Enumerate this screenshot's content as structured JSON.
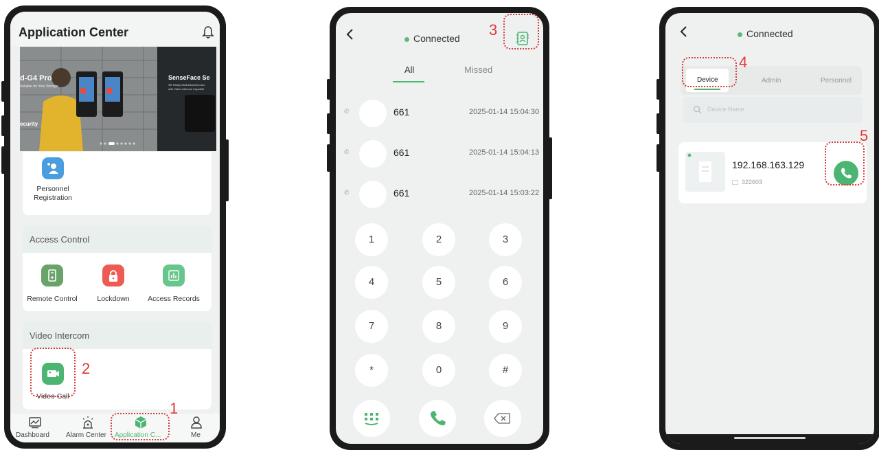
{
  "phone1": {
    "title": "Application Center",
    "banner": {
      "left_text": "d-G4 Pro",
      "left_sub": "Solution for Your Storage",
      "left_bottom": "ecurity",
      "right_text": "SenseFace Se",
      "right_sub": "SR Ready Multi-Biometric Acc",
      "right_sub2": "with Video Intercom Capabilit"
    },
    "personnel_registration": [
      "Personnel",
      "Registration"
    ],
    "access_control": {
      "title": "Access Control",
      "items": [
        "Remote Control",
        "Lockdown",
        "Access Records"
      ]
    },
    "video_intercom": {
      "title": "Video Intercom",
      "item": "Video Call"
    },
    "tabs": [
      "Dashboard",
      "Alarm Center",
      "Application C...",
      "Me"
    ]
  },
  "phone2": {
    "status": "Connected",
    "tabs": [
      "All",
      "Missed"
    ],
    "calls": [
      {
        "name": "661",
        "time": "2025-01-14 15:04:30"
      },
      {
        "name": "661",
        "time": "2025-01-14 15:04:13"
      },
      {
        "name": "661",
        "time": "2025-01-14 15:03:22"
      }
    ],
    "keys": [
      "1",
      "2",
      "3",
      "4",
      "5",
      "6",
      "7",
      "8",
      "9",
      "*",
      "0",
      "#"
    ]
  },
  "phone3": {
    "status": "Connected",
    "tabs": [
      "Device",
      "Admin",
      "Personnel"
    ],
    "search_placeholder": "Device Name",
    "device": {
      "ip": "192.168.163.129",
      "id": "322603"
    }
  },
  "annotations": [
    "1",
    "2",
    "3",
    "4",
    "5"
  ],
  "colors": {
    "accent_green": "#4cb572",
    "red_annotation": "#e0393a",
    "lockdown_red": "#ee5b55"
  }
}
